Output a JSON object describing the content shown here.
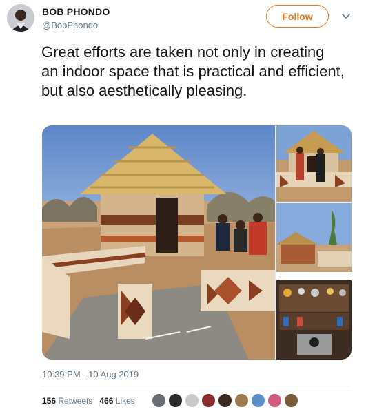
{
  "author": {
    "name": "BOB PHONDO",
    "handle": "@BobPhondo"
  },
  "follow_label": "Follow",
  "tweet_text": "Great efforts are taken not only in creating an indoor space that is practical and efficient, but also aesthetically pleasing.",
  "timestamp": "10:39 PM - 10 Aug 2019",
  "stats": {
    "retweets_count": "156",
    "retweets_label": "Retweets",
    "likes_count": "466",
    "likes_label": "Likes"
  },
  "colors": {
    "accent": "#e8751a",
    "text": "#14171a",
    "muted": "#657786"
  },
  "icons": {
    "more": "chevron-down-icon"
  },
  "liker_colors": [
    "#6b6f75",
    "#2b2b2b",
    "#c9c9c9",
    "#8a2d2d",
    "#3b2a20",
    "#9e7b4f",
    "#5a8cc8",
    "#d25a7a",
    "#7a5c3d"
  ]
}
